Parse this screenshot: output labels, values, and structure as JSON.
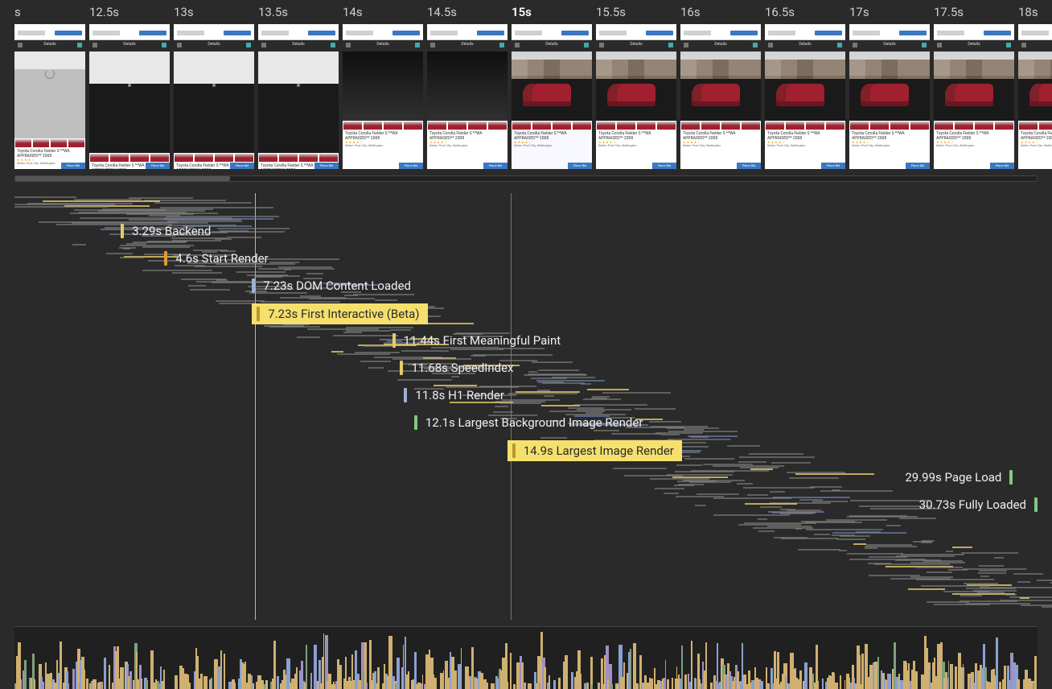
{
  "filmstrip": {
    "first_label": "s",
    "times": [
      "12.5s",
      "13s",
      "13.5s",
      "14s",
      "14.5s",
      "15s",
      "15.5s",
      "16s",
      "16.5s",
      "17s",
      "17.5s",
      "18s"
    ],
    "current_index": 5,
    "listing": {
      "title": "Toyota Corolla Fielder S **WA APPRAISED** 2008",
      "stars": "★ ★ ★ ★ ☆",
      "location": "Seller: Port City, Wellington",
      "cta": "Place Bid",
      "nav": "Details"
    },
    "scrollbar_pct": 21
  },
  "timeline": {
    "total_seconds": 30.73,
    "playhead_seconds": 15.0
  },
  "metrics": [
    {
      "id": "backend",
      "time": "3.29s",
      "label": "Backend",
      "seconds": 3.29,
      "row": 1,
      "style": "gold",
      "highlight": false
    },
    {
      "id": "start-render",
      "time": "4.6s",
      "label": "Start Render",
      "seconds": 4.6,
      "row": 2,
      "style": "orange",
      "highlight": false
    },
    {
      "id": "dom-content-loaded",
      "time": "7.23s",
      "label": "DOM Content Loaded",
      "seconds": 7.23,
      "row": 3,
      "style": "blue",
      "highlight": false
    },
    {
      "id": "first-interactive",
      "time": "7.23s",
      "label": "First Interactive (Beta)",
      "seconds": 7.23,
      "row": 4,
      "style": "gold",
      "highlight": true
    },
    {
      "id": "first-meaningful-paint",
      "time": "11.44s",
      "label": "First Meaningful Paint",
      "seconds": 11.44,
      "row": 5,
      "style": "gold",
      "highlight": false
    },
    {
      "id": "speedindex",
      "time": "11.68s",
      "label": "SpeedIndex",
      "seconds": 11.68,
      "row": 6,
      "style": "gold",
      "highlight": false
    },
    {
      "id": "h1-render",
      "time": "11.8s",
      "label": "H1 Render",
      "seconds": 11.8,
      "row": 7,
      "style": "blue",
      "highlight": false
    },
    {
      "id": "largest-bg-image",
      "time": "12.1s",
      "label": "Largest Background Image Render",
      "seconds": 12.1,
      "row": 8,
      "style": "green",
      "highlight": false
    },
    {
      "id": "largest-image",
      "time": "14.9s",
      "label": "Largest Image Render",
      "seconds": 14.9,
      "row": 9,
      "style": "gold",
      "highlight": true
    },
    {
      "id": "page-load",
      "time": "29.99s",
      "label": "Page Load",
      "seconds": 29.99,
      "row": 10,
      "style": "green",
      "highlight": false,
      "tick_right": true
    },
    {
      "id": "fully-loaded",
      "time": "30.73s",
      "label": "Fully Loaded",
      "seconds": 30.73,
      "row": 11,
      "style": "green",
      "highlight": false,
      "tick_right": true
    }
  ],
  "vlines": [
    {
      "seconds": 7.23,
      "kind": "gold"
    },
    {
      "seconds": 14.9,
      "kind": "playhead"
    }
  ]
}
